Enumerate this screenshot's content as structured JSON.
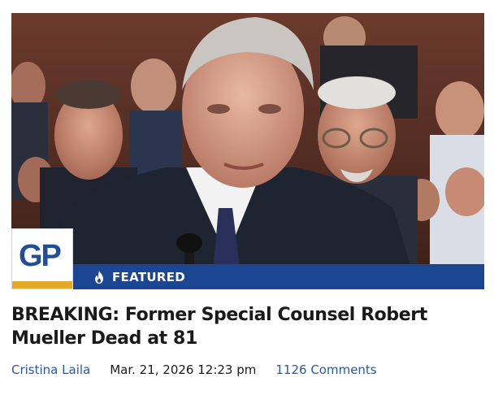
{
  "article": {
    "badge": "FEATURED",
    "headline": "BREAKING: Former Special Counsel Robert Mueller Dead at 81",
    "author": "Cristina Laila",
    "date": "Mar. 21, 2026 12:23 pm",
    "comments": "1126 Comments"
  },
  "logo": {
    "text": "GP"
  },
  "icons": {
    "featured": "flame-icon"
  },
  "colors": {
    "brand_blue": "#1c4592",
    "logo_blue": "#1f4e9a",
    "logo_gold": "#e5a929",
    "link_blue": "#2a57a8",
    "headline": "#1a1a1a"
  }
}
